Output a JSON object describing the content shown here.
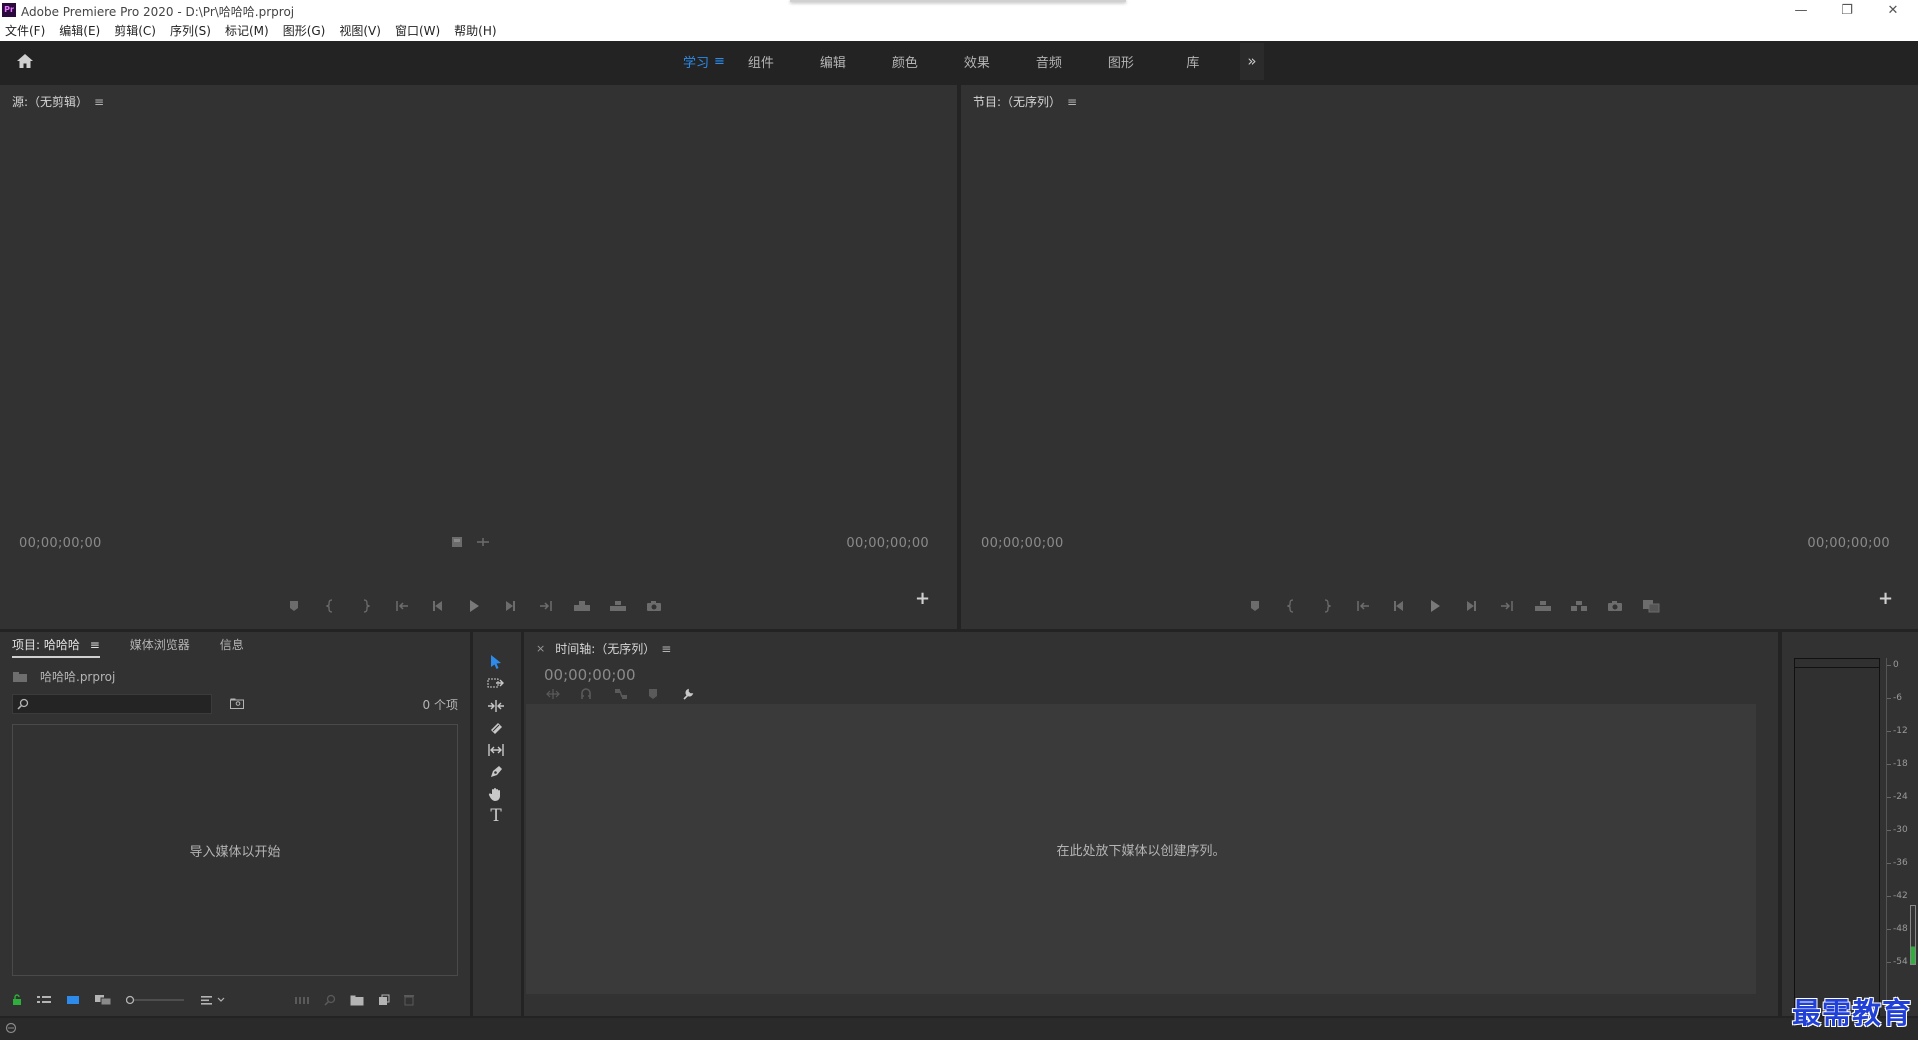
{
  "window": {
    "logo_text": "Pr",
    "title": "Adobe Premiere Pro 2020 - D:\\Pr\\哈哈哈.prproj",
    "minimize": "—",
    "maximize": "❐",
    "close": "✕"
  },
  "menu": [
    "文件(F)",
    "编辑(E)",
    "剪辑(C)",
    "序列(S)",
    "标记(M)",
    "图形(G)",
    "视图(V)",
    "窗口(W)",
    "帮助(H)"
  ],
  "workspaces": {
    "tabs": [
      "学习",
      "组件",
      "编辑",
      "颜色",
      "效果",
      "音频",
      "图形",
      "库"
    ],
    "active": "学习",
    "menu_icon": "≡",
    "more": "»"
  },
  "source_monitor": {
    "title": "源:（无剪辑）",
    "menu_icon": "≡",
    "timecode_left": "00;00;00;00",
    "timecode_right": "00;00;00;00",
    "add_label": "+"
  },
  "program_monitor": {
    "title": "节目:（无序列）",
    "menu_icon": "≡",
    "timecode_left": "00;00;00;00",
    "timecode_right": "00;00;00;00",
    "add_label": "+"
  },
  "project": {
    "tabs": [
      "项目: 哈哈哈",
      "媒体浏览器",
      "信息"
    ],
    "active_tab": "项目: 哈哈哈",
    "menu_icon": "≡",
    "file_name": "哈哈哈.prproj",
    "search_placeholder": "",
    "item_count": "0 个项",
    "empty_hint": "导入媒体以开始"
  },
  "timeline": {
    "close_label": "×",
    "title": "时间轴:（无序列）",
    "menu_icon": "≡",
    "timecode": "00;00;00;00",
    "empty_hint": "在此处放下媒体以创建序列。"
  },
  "audio_meter": {
    "scale": [
      "0",
      "-6",
      "-12",
      "-18",
      "-24",
      "-30",
      "-36",
      "-42",
      "-48",
      "-54"
    ],
    "level_fraction": 0.3
  },
  "colors": {
    "accent": "#2d8ceb",
    "panel": "#323232",
    "background": "#232323",
    "meter_green": "#2eae3a",
    "watermark": "#2040d8"
  },
  "watermark_text": "最需教育"
}
